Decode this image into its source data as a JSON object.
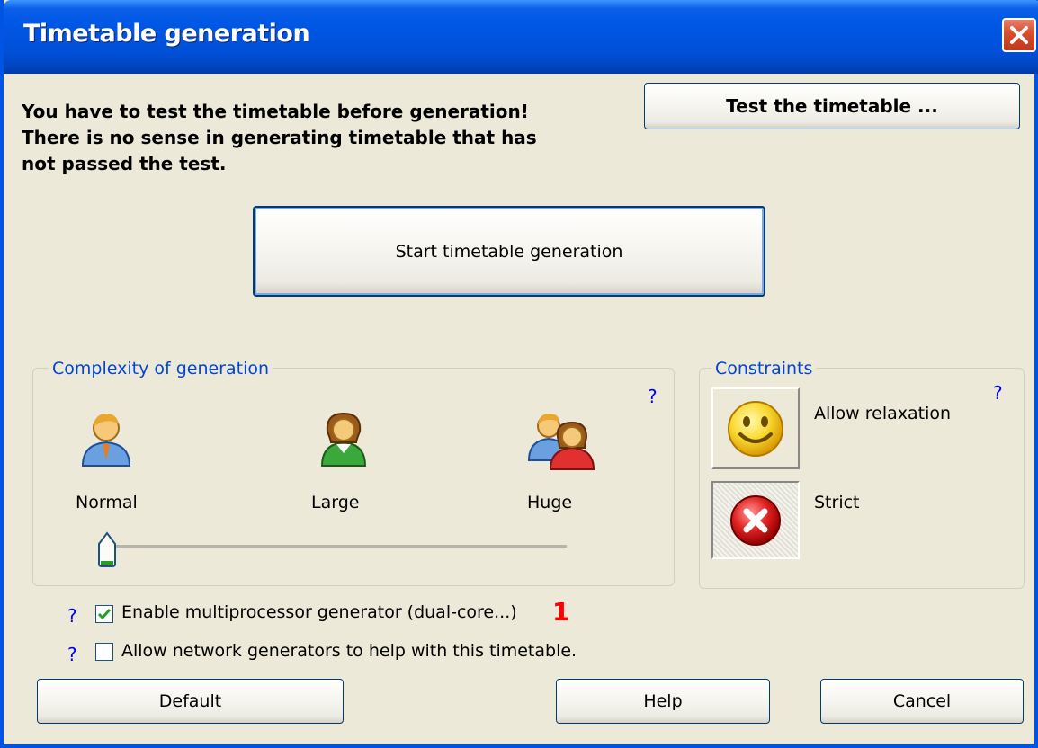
{
  "window": {
    "title": "Timetable generation"
  },
  "header": {
    "warning_lines": [
      "You have to test the timetable before generation!",
      "There is no sense in generating timetable that has",
      "not passed the test."
    ],
    "test_button_label": "Test the timetable ..."
  },
  "main": {
    "start_button_label": "Start timetable generation"
  },
  "complexity": {
    "legend": "Complexity of generation",
    "help": "?",
    "levels": [
      "Normal",
      "Large",
      "Huge"
    ],
    "selected_level": "Normal"
  },
  "constraints": {
    "legend": "Constraints",
    "help": "?",
    "relax_label": "Allow relaxation",
    "strict_label": "Strict",
    "selected": "Strict"
  },
  "options": {
    "multiprocessor": {
      "help": "?",
      "label": "Enable multiprocessor generator (dual-core...)",
      "checked": true,
      "badge": "1"
    },
    "network": {
      "help": "?",
      "label": "Allow network generators to help with this timetable.",
      "checked": false
    }
  },
  "footer": {
    "default_label": "Default",
    "help_label": "Help",
    "cancel_label": "Cancel"
  },
  "colors": {
    "title_bar": "#0054e3",
    "dialog_bg": "#ece9d8",
    "group_legend": "#0046d5",
    "help_mark": "#0000ff",
    "badge": "#ff0000",
    "close_button": "#d8502f"
  },
  "icons": [
    "close-icon",
    "person-normal-icon",
    "person-large-icon",
    "people-huge-icon",
    "smiley-icon",
    "red-x-icon",
    "checkmark-icon"
  ]
}
